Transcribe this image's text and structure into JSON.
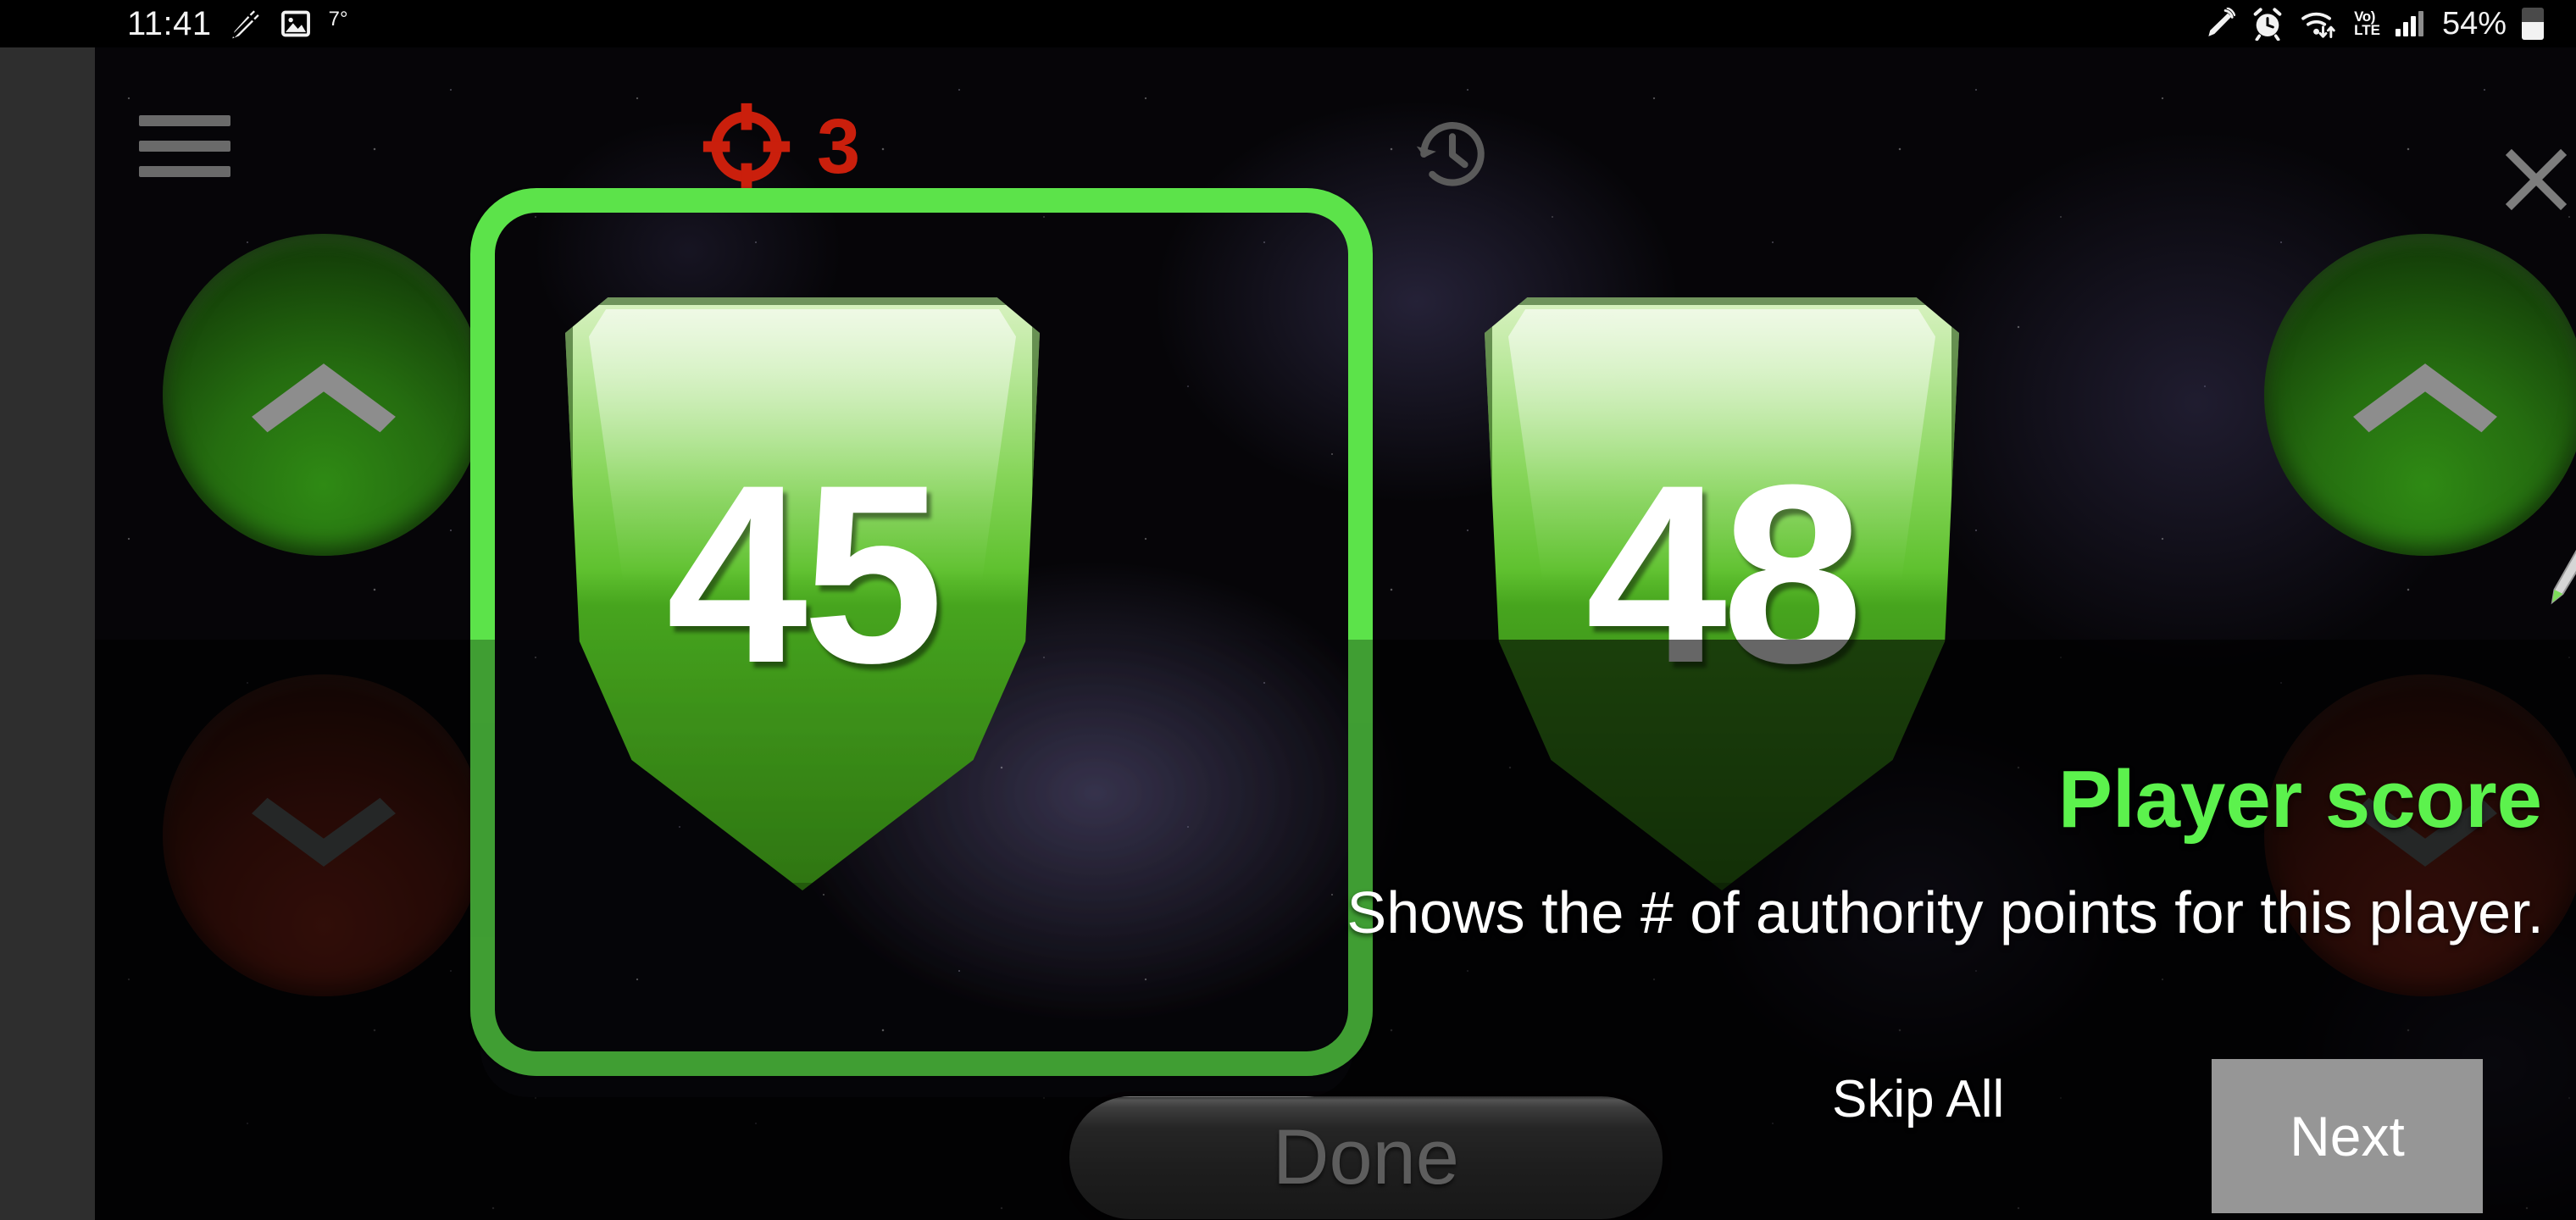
{
  "status_bar": {
    "time": "11:41",
    "temperature": "7°",
    "battery_percent": "54%",
    "volte_line1": "Vo)",
    "volte_line2": "LTE",
    "icons": [
      "stylus-off-icon",
      "screenshot-image-icon",
      "s-pen-icon",
      "alarm-icon",
      "wifi-icon",
      "volte-icon",
      "signal-bars-icon",
      "battery-icon"
    ]
  },
  "game_header": {
    "menu_label": "menu",
    "attack_count": "3",
    "attack_icon": "target-crosshair-icon",
    "history_icon": "history-restore-icon",
    "close_icon": "close-x-icon"
  },
  "players": [
    {
      "id": "player-1",
      "score": "45",
      "increment_label": "increase score",
      "decrement_label": "decrease score"
    },
    {
      "id": "player-2",
      "score": "48",
      "increment_label": "increase score",
      "decrement_label": "decrease score"
    }
  ],
  "done_button": {
    "label": "Done"
  },
  "tutorial": {
    "title": "Player score",
    "body": "Shows the # of authority points for this player.",
    "skip_label": "Skip All",
    "next_label": "Next",
    "highlight_color": "#5ce34a",
    "title_color": "#5cf24d",
    "next_button_color": "#969696"
  },
  "colors": {
    "accent_green": "#5ce34a",
    "attack_red": "#ca1f0c",
    "shield_green": "#47a51e",
    "edge_bar": "#2e2e2e",
    "status_text": "#f2f2f2"
  }
}
